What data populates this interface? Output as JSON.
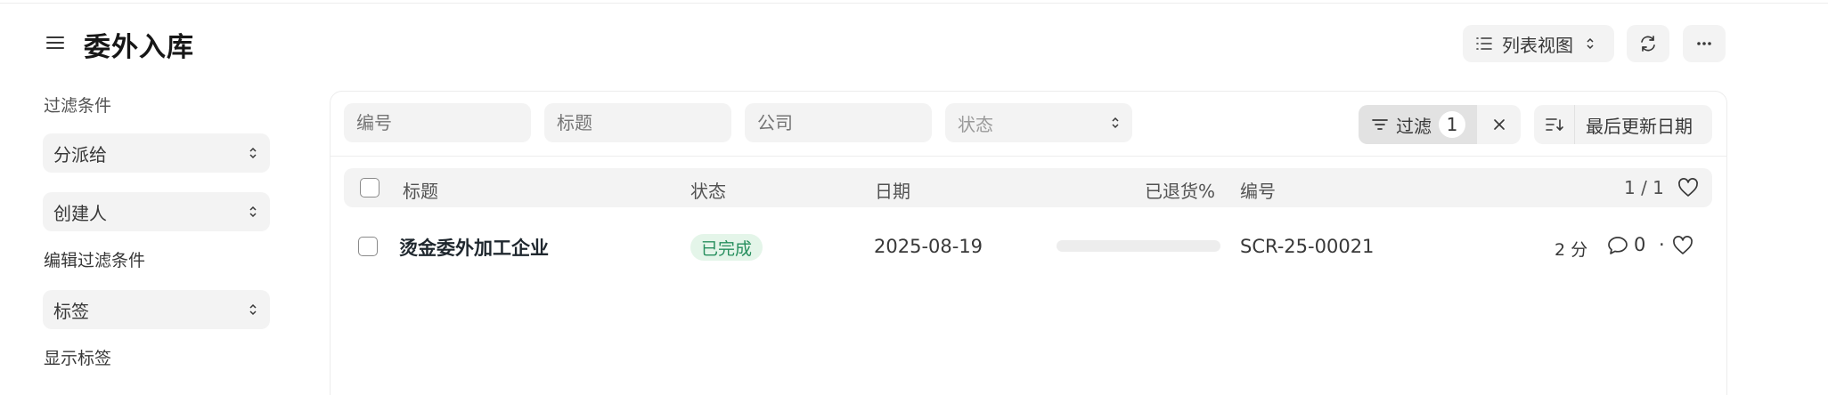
{
  "header": {
    "title": "委外入库",
    "view_label": "列表视图"
  },
  "sidebar": {
    "filter_section_label": "过滤条件",
    "assigned_to": "分派给",
    "created_by": "创建人",
    "edit_filters": "编辑过滤条件",
    "tags": "标签",
    "show_tags": "显示标签"
  },
  "filters": {
    "id_placeholder": "编号",
    "title_placeholder": "标题",
    "company_placeholder": "公司",
    "status_placeholder": "状态",
    "filter_label": "过滤",
    "filter_count": "1",
    "sort_field": "最后更新日期"
  },
  "table": {
    "columns": {
      "title": "标题",
      "status": "状态",
      "date": "日期",
      "returned": "已退货%",
      "id": "编号"
    },
    "count": "1 / 1",
    "rows": [
      {
        "title": "烫金委外加工企业",
        "status": "已完成",
        "date": "2025-08-19",
        "returned_percent": 0,
        "id": "SCR-25-00021",
        "modified": "2 分",
        "comments": "0",
        "separator": "·"
      }
    ]
  },
  "colors": {
    "status_completed_bg": "#e4f5e9",
    "status_completed_text": "#278f5e",
    "control_bg": "#f3f3f3"
  }
}
